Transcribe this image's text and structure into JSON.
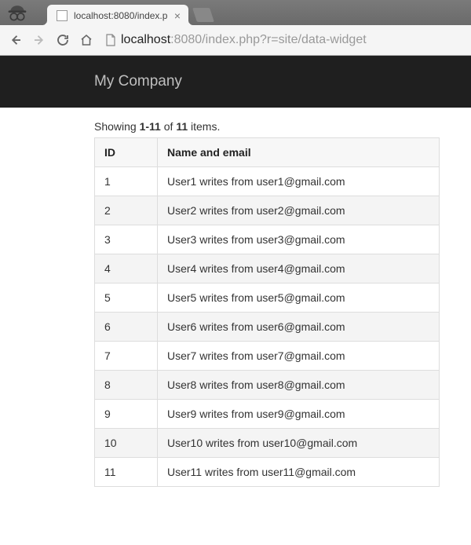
{
  "browser": {
    "tab_title": "localhost:8080/index.p",
    "url_host": "localhost",
    "url_path": ":8080/index.php?r=site/data-widget"
  },
  "header": {
    "brand": "My Company"
  },
  "grid": {
    "summary_prefix": "Showing ",
    "summary_range": "1-11",
    "summary_mid": " of ",
    "summary_total": "11",
    "summary_suffix": " items.",
    "columns": {
      "id": "ID",
      "name_email": "Name and email"
    },
    "rows": [
      {
        "id": "1",
        "text": "User1 writes from user1@gmail.com"
      },
      {
        "id": "2",
        "text": "User2 writes from user2@gmail.com"
      },
      {
        "id": "3",
        "text": "User3 writes from user3@gmail.com"
      },
      {
        "id": "4",
        "text": "User4 writes from user4@gmail.com"
      },
      {
        "id": "5",
        "text": "User5 writes from user5@gmail.com"
      },
      {
        "id": "6",
        "text": "User6 writes from user6@gmail.com"
      },
      {
        "id": "7",
        "text": "User7 writes from user7@gmail.com"
      },
      {
        "id": "8",
        "text": "User8 writes from user8@gmail.com"
      },
      {
        "id": "9",
        "text": "User9 writes from user9@gmail.com"
      },
      {
        "id": "10",
        "text": "User10 writes from user10@gmail.com"
      },
      {
        "id": "11",
        "text": "User11 writes from user11@gmail.com"
      }
    ]
  }
}
